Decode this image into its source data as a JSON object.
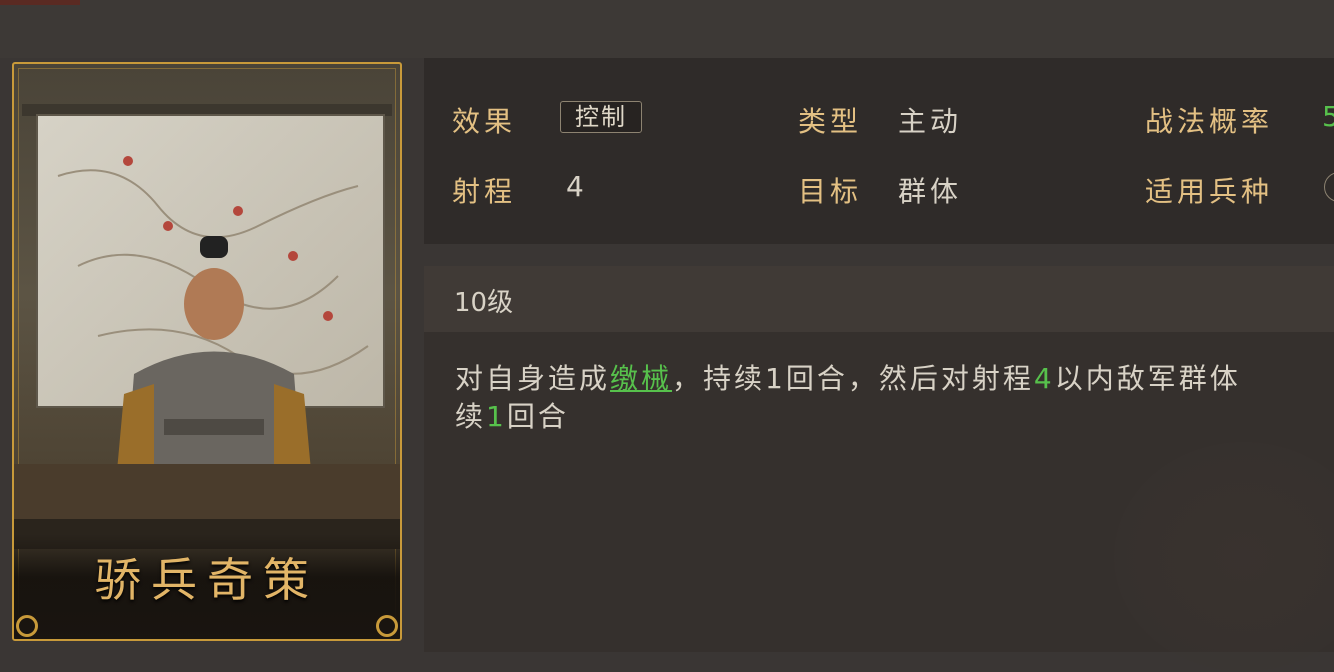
{
  "card": {
    "name": "骄兵奇策",
    "frame_color": "#c89a3a"
  },
  "info": {
    "effect_label": "效果",
    "effect_value": "控制",
    "type_label": "类型",
    "type_value": "主动",
    "rate_label": "战法概率",
    "rate_value": "5",
    "range_label": "射程",
    "range_value": "4",
    "target_label": "目标",
    "target_value": "群体",
    "troops_label": "适用兵种"
  },
  "description": {
    "level": "10级",
    "segments": [
      {
        "text": "对自身造成",
        "style": "normal"
      },
      {
        "text": "缴械",
        "style": "keyword"
      },
      {
        "text": "，持续1回合，然后对射程",
        "style": "normal"
      },
      {
        "text": "4",
        "style": "number"
      },
      {
        "text": "以内敌军群体",
        "style": "normal"
      },
      {
        "text": "续",
        "style": "normal"
      },
      {
        "text": "1",
        "style": "number"
      },
      {
        "text": "回合",
        "style": "normal"
      }
    ]
  },
  "colors": {
    "label": "#e3c083",
    "highlight": "#57c14c",
    "text": "#d8d2c6"
  }
}
